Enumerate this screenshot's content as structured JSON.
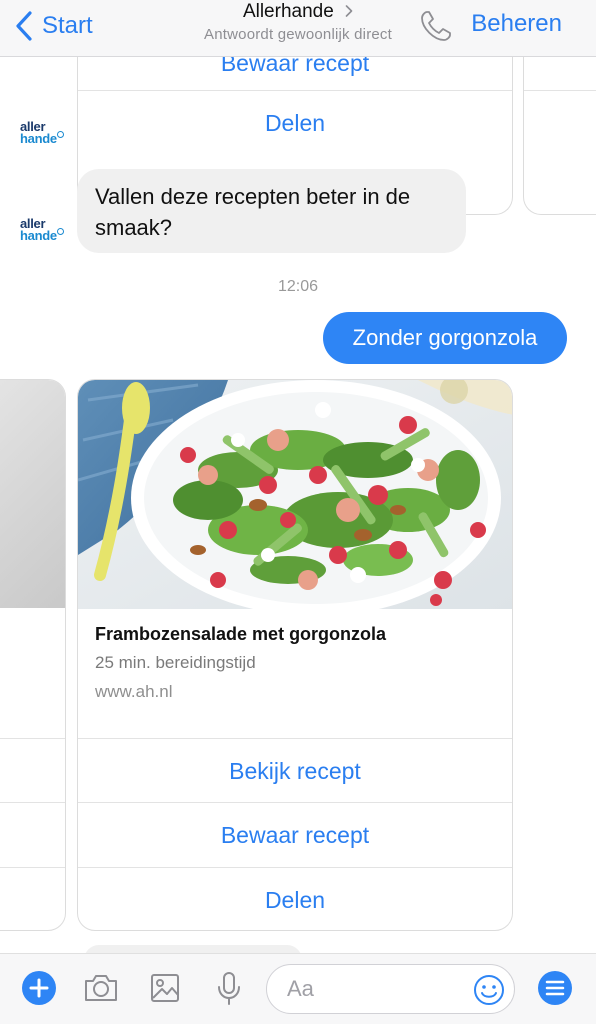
{
  "header": {
    "back_label": "Start",
    "title": "Allerhande",
    "subtitle": "Antwoordt gewoonlijk direct",
    "manage_label": "Beheren"
  },
  "avatar": {
    "line1": "aller",
    "line2": "hande"
  },
  "previous_card": {
    "buttons": [
      "Bewaar recept",
      "Delen"
    ]
  },
  "messages": {
    "bot_question": "Vallen deze recepten beter in de smaak?",
    "timestamp": "12:06",
    "user_reply": "Zonder gorgonzola"
  },
  "recipe_card": {
    "title": "Frambozensalade met gorgonzola",
    "meta": "25 min. bereidingstijd",
    "url": "www.ah.nl",
    "buttons": [
      "Bekijk recept",
      "Bewaar recept",
      "Delen"
    ]
  },
  "composer": {
    "placeholder": "Aa"
  },
  "colors": {
    "accent": "#2a7ef0",
    "user_bubble": "#2e85f5",
    "bot_bubble": "#f0f0f0"
  },
  "icons": [
    "chevron-left-icon",
    "chevron-right-icon",
    "phone-icon",
    "plus-icon",
    "camera-icon",
    "image-icon",
    "microphone-icon",
    "emoji-icon",
    "menu-icon"
  ]
}
